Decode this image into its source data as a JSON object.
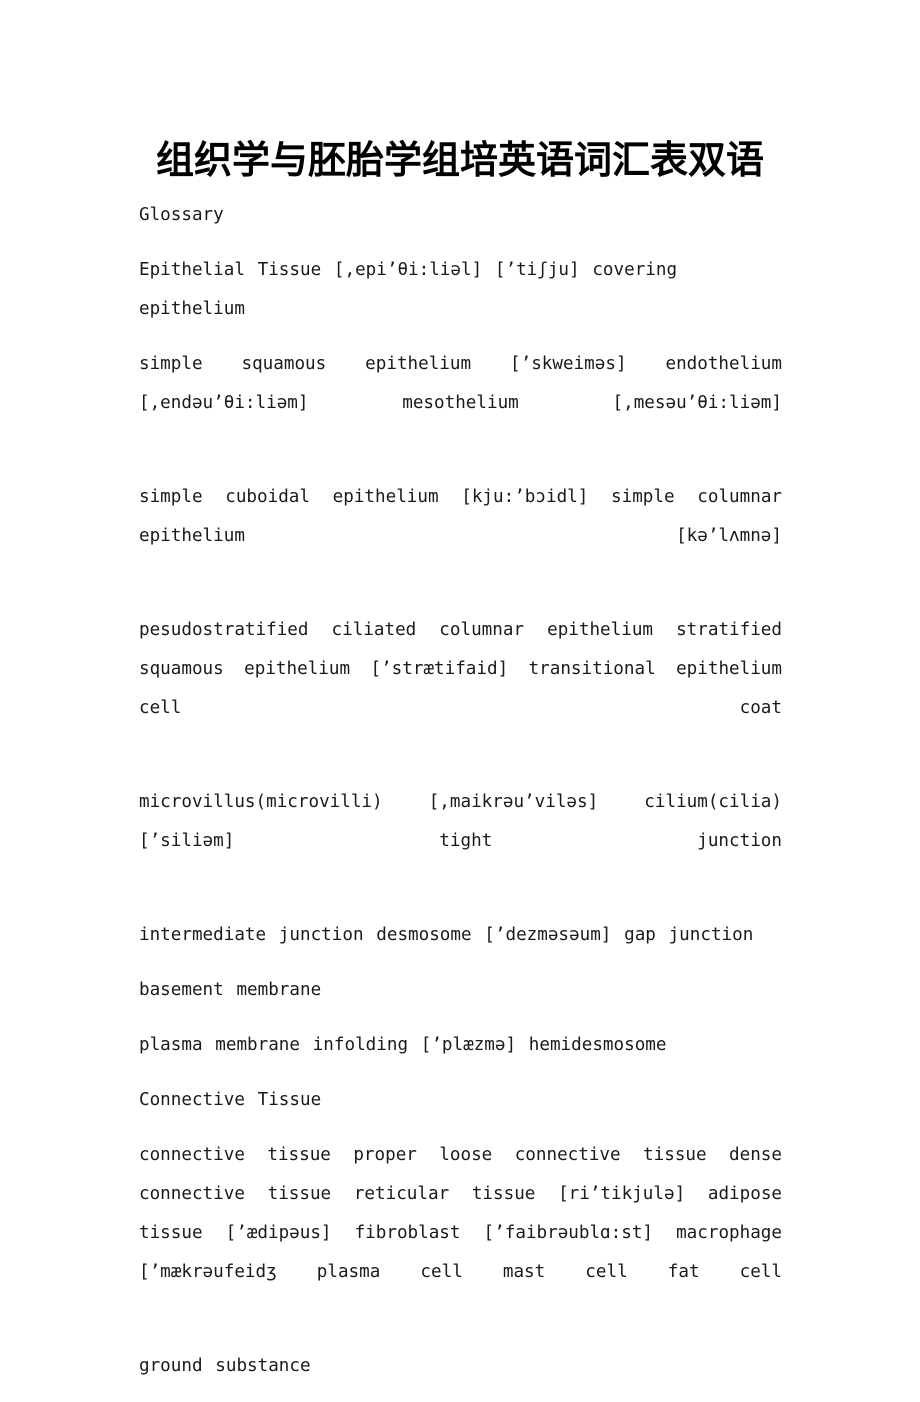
{
  "document": {
    "title": "组织学与胚胎学组培英语词汇表双语",
    "page_background": "#ffffff",
    "text_color": "#1a1a1a"
  },
  "content": {
    "heading_glossary": "Glossary",
    "paragraphs": [
      {
        "id": "p-epithelial-tissue",
        "name": "paragraph-epithelial-tissue",
        "single_line": true,
        "text": "Epithelial Tissue [,epi’θi:liəl]  [’tiʃju] covering epithelium"
      },
      {
        "id": "p-simple-squamous",
        "name": "paragraph-simple-squamous-epithelium",
        "single_line": false,
        "text": "simple squamous epithelium [’skweiməs] endothelium [,endəu’θi:liəm] mesothelium [,mesəu’θi:liəm]"
      },
      {
        "id": "p-simple-cuboidal",
        "name": "paragraph-simple-cuboidal-epithelium",
        "single_line": false,
        "text": "simple cuboidal epithelium [kju:’bɔidl] simple columnar epithelium [kə’lʌmnə]"
      },
      {
        "id": "p-pseudostratified",
        "name": "paragraph-pseudostratified-epithelium",
        "single_line": false,
        "text": "pesudostratified ciliated columnar epithelium stratified squamous epithelium [’strætifaid] transitional epithelium cell coat"
      },
      {
        "id": "p-microvillus",
        "name": "paragraph-microvillus-cilium",
        "single_line": false,
        "text": "microvillus(microvilli) [,maikrəu’viləs] cilium(cilia) [’siliəm] tight junction"
      },
      {
        "id": "p-intermediate-junction",
        "name": "paragraph-intermediate-junction",
        "single_line": true,
        "text": "intermediate junction desmosome [’dezməsəum] gap junction"
      },
      {
        "id": "p-basement-membrane",
        "name": "paragraph-basement-membrane",
        "single_line": true,
        "text": "basement membrane"
      },
      {
        "id": "p-plasma-membrane",
        "name": "paragraph-plasma-membrane-infolding",
        "single_line": true,
        "text": "plasma membrane infolding [’plæzmə] hemidesmosome"
      },
      {
        "id": "p-connective-tissue-heading",
        "name": "paragraph-connective-tissue-heading",
        "single_line": true,
        "text": "Connective Tissue"
      },
      {
        "id": "p-connective-tissue-terms",
        "name": "paragraph-connective-tissue-terms",
        "single_line": false,
        "text": "connective tissue proper loose connective tissue dense connective tissue reticular tissue [ri’tikjulə] adipose tissue [’ædipəus] fibroblast [’faibrəublɑ:st] macrophage [’mækrəufeidʒ plasma cell mast cell fat cell"
      },
      {
        "id": "p-ground-substance",
        "name": "paragraph-ground-substance",
        "single_line": true,
        "text": "ground substance"
      }
    ]
  }
}
